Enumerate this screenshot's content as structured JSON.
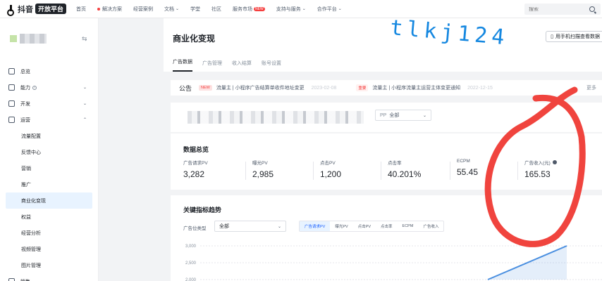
{
  "topbar": {
    "logo_text": "抖音",
    "logo_badge": "开放平台",
    "nav": [
      {
        "label": "首页"
      },
      {
        "label": "解决方案",
        "dot": true
      },
      {
        "label": "经营案例"
      },
      {
        "label": "文档",
        "chevron": true
      },
      {
        "label": "学堂"
      },
      {
        "label": "社区"
      },
      {
        "label": "服务市场",
        "badge": "NEW"
      },
      {
        "label": "支持与服务",
        "chevron": true
      },
      {
        "label": "合作平台",
        "chevron": true
      }
    ],
    "search_placeholder": "搜索"
  },
  "sidebar": {
    "menu": [
      {
        "label": "总览",
        "level": "top",
        "icon": "overview-icon"
      },
      {
        "label": "能力",
        "level": "top",
        "icon": "capability-icon",
        "info": true,
        "chevron": "⌄"
      },
      {
        "label": "开发",
        "level": "top",
        "icon": "code-icon",
        "chevron": "⌄"
      },
      {
        "label": "运营",
        "level": "top",
        "icon": "operation-icon",
        "chevron": "⌃"
      },
      {
        "label": "流量配置",
        "level": "sub"
      },
      {
        "label": "反馈中心",
        "level": "sub"
      },
      {
        "label": "营销",
        "level": "sub"
      },
      {
        "label": "推广",
        "level": "sub"
      },
      {
        "label": "商业化变现",
        "level": "sub",
        "active": true
      },
      {
        "label": "权益",
        "level": "sub"
      },
      {
        "label": "经营分析",
        "level": "sub"
      },
      {
        "label": "视频管理",
        "level": "sub"
      },
      {
        "label": "图片管理",
        "level": "sub"
      },
      {
        "label": "销售",
        "level": "top",
        "icon": "sales-icon",
        "chevron": "⌄"
      }
    ]
  },
  "header": {
    "title": "商业化变现",
    "mobile_button": "用手机扫描查看数据"
  },
  "tabs": [
    {
      "label": "广告数据",
      "active": true
    },
    {
      "label": "广告管理"
    },
    {
      "label": "收入结算"
    },
    {
      "label": "账号设置"
    }
  ],
  "notice": {
    "label": "公告",
    "items": [
      {
        "tag": "NEW",
        "text": "流量主 | 小程序广告结算单收件地址变更",
        "date": "2023-02-08"
      },
      {
        "tag": "重要",
        "text": "流量主 | 小程序流量主运营主体变更通知",
        "date": "2022-12-15"
      }
    ],
    "more": "更多"
  },
  "filter": {
    "pp_label": "PP",
    "pp_value": "全部"
  },
  "stats": {
    "title": "数据总览",
    "metrics": [
      {
        "label": "广告请求PV",
        "value": "3,282"
      },
      {
        "label": "曝光PV",
        "value": "2,985"
      },
      {
        "label": "点击PV",
        "value": "1,200"
      },
      {
        "label": "点击率",
        "value": "40.201%"
      },
      {
        "label": "ECPM",
        "value": "55.45"
      },
      {
        "label": "广告收入(元)",
        "value": "165.53",
        "info": true
      }
    ]
  },
  "trend": {
    "title": "关键指标趋势",
    "filter_label": "广告位类型",
    "filter_value": "全部",
    "metric_tabs": [
      {
        "label": "广告请求PV",
        "active": true
      },
      {
        "label": "曝光PV"
      },
      {
        "label": "点击PV"
      },
      {
        "label": "点击率"
      },
      {
        "label": "ECPM"
      },
      {
        "label": "广告收入"
      }
    ]
  },
  "chart_data": {
    "type": "area",
    "title": "关键指标趋势",
    "y_ticks": [
      "3,000",
      "2,500",
      "2,000"
    ],
    "series": [
      {
        "name": "广告请求PV",
        "values": [
          2000,
          3000
        ]
      }
    ],
    "ylim": [
      2000,
      3000
    ],
    "color": "#4a8fe0"
  },
  "overlay": {
    "watermark_text": "tlkj124",
    "circle_color": "#f0443e"
  },
  "colors": {
    "accent": "#165dff",
    "active_bg": "#e8f3ff",
    "danger": "#f53f3f"
  }
}
